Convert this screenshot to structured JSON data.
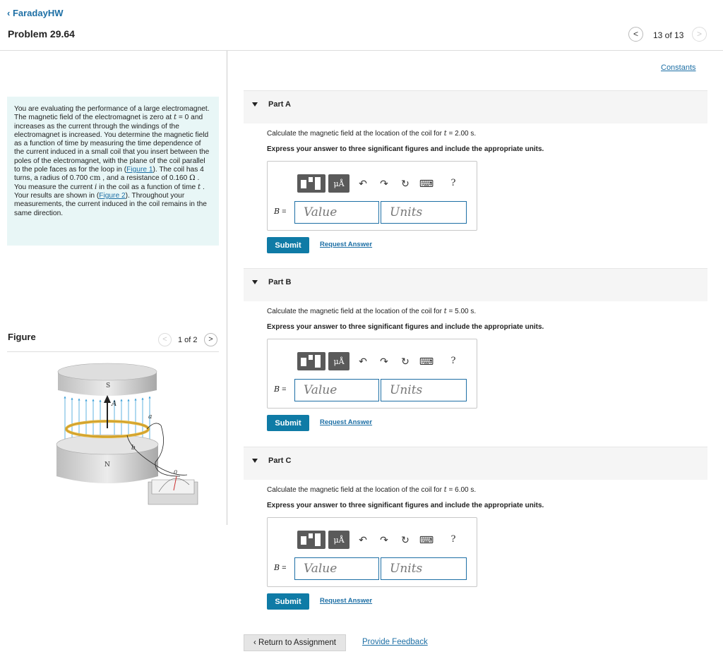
{
  "header": {
    "back_label": "FaradayHW",
    "problem_title": "Problem 29.64",
    "prev_icon": "chevron-left-icon",
    "next_icon": "chevron-right-icon",
    "counter": "13 of 13"
  },
  "intro": {
    "t1": "You are evaluating the performance of a large electromagnet. The magnetic field of the electromagnet is zero at ",
    "var_t": "t",
    "t2": " = 0 and increases as the current through the windings of the electromagnet is increased. You determine the magnetic field as a function of time by measuring the time dependence of the current induced in a small coil that you insert between the poles of the electromagnet, with the plane of the coil parallel to the pole faces as for the loop in (",
    "fig1_link": "Figure 1",
    "t3": "). The coil has 4 turns, a radius of 0.700 ",
    "cm": "cm",
    "t4": " , and a resistance of 0.160 ",
    "ohm": "Ω",
    "t5": " . You measure the current ",
    "var_i": "i",
    "t6": " in the coil as a function of time ",
    "t7": " . Your results are shown in (",
    "fig2_link": "Figure 2",
    "t8": "). Throughout your measurements, the current induced in the coil remains in the same direction."
  },
  "figure": {
    "title": "Figure",
    "counter": "1 of 2",
    "labels": {
      "s": "S",
      "n": "N",
      "a": "a",
      "b": "b",
      "vec": "A",
      "zero": "0"
    }
  },
  "constants_link": "Constants",
  "toolbar": {
    "mu_label": "μÅ",
    "undo": "↶",
    "redo": "↷",
    "reset": "↻",
    "keyboard": "⌨",
    "help": "?"
  },
  "parts": [
    {
      "label": "Part A",
      "q_pre": "Calculate the magnetic field at the location of the coil for ",
      "q_var": "t",
      "q_post": " = 2.00 s.",
      "instructions": "Express your answer to three significant figures and include the appropriate units.",
      "var": "B",
      "eq": " =",
      "value_placeholder": "Value",
      "units_placeholder": "Units",
      "submit": "Submit",
      "request": "Request Answer"
    },
    {
      "label": "Part B",
      "q_pre": "Calculate the magnetic field at the location of the coil for ",
      "q_var": "t",
      "q_post": " = 5.00 s.",
      "instructions": "Express your answer to three significant figures and include the appropriate units.",
      "var": "B",
      "eq": " =",
      "value_placeholder": "Value",
      "units_placeholder": "Units",
      "submit": "Submit",
      "request": "Request Answer"
    },
    {
      "label": "Part C",
      "q_pre": "Calculate the magnetic field at the location of the coil for ",
      "q_var": "t",
      "q_post": " = 6.00 s.",
      "instructions": "Express your answer to three significant figures and include the appropriate units.",
      "var": "B",
      "eq": " =",
      "value_placeholder": "Value",
      "units_placeholder": "Units",
      "submit": "Submit",
      "request": "Request Answer"
    }
  ],
  "footer": {
    "return_label": "Return to Assignment",
    "feedback_link": "Provide Feedback"
  }
}
